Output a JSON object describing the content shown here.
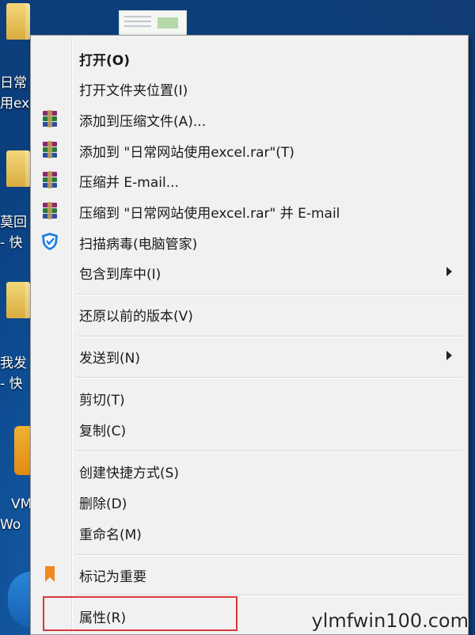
{
  "desktop": {
    "icon_labels": [
      {
        "line1": "日常",
        "line2": "用ex"
      },
      {
        "line1": "莫回",
        "line2": "- 快"
      },
      {
        "line1": "我发",
        "line2": "- 快"
      },
      {
        "line1": "VM",
        "line2": "Wo"
      }
    ]
  },
  "menu": {
    "items": [
      {
        "label": "打开(O)",
        "bold": true,
        "icon": ""
      },
      {
        "label": "打开文件夹位置(I)",
        "icon": ""
      },
      {
        "label": "添加到压缩文件(A)...",
        "icon": "winrar-books-icon"
      },
      {
        "label": "添加到 \"日常网站使用excel.rar\"(T)",
        "icon": "winrar-books-icon"
      },
      {
        "label": "压缩并 E-mail...",
        "icon": "winrar-books-icon"
      },
      {
        "label": "压缩到 \"日常网站使用excel.rar\" 并 E-mail",
        "icon": "winrar-books-icon"
      },
      {
        "label": "扫描病毒(电脑管家)",
        "icon": "shield-check-icon"
      },
      {
        "label": "包含到库中(I)",
        "submenu": true,
        "icon": ""
      },
      {
        "label": "还原以前的版本(V)",
        "icon": ""
      },
      {
        "label": "发送到(N)",
        "submenu": true,
        "icon": ""
      },
      {
        "label": "剪切(T)",
        "icon": ""
      },
      {
        "label": "复制(C)",
        "icon": ""
      },
      {
        "label": "创建快捷方式(S)",
        "icon": ""
      },
      {
        "label": "删除(D)",
        "icon": ""
      },
      {
        "label": "重命名(M)",
        "icon": ""
      },
      {
        "label": "标记为重要",
        "icon": "bookmark-icon"
      },
      {
        "label": "属性(R)",
        "icon": ""
      }
    ]
  },
  "colors": {
    "highlight_border": "#d9383a",
    "shield": "#1e7fe0",
    "bookmark": "#f08a1c"
  },
  "watermark": "ylmfwin100.com"
}
